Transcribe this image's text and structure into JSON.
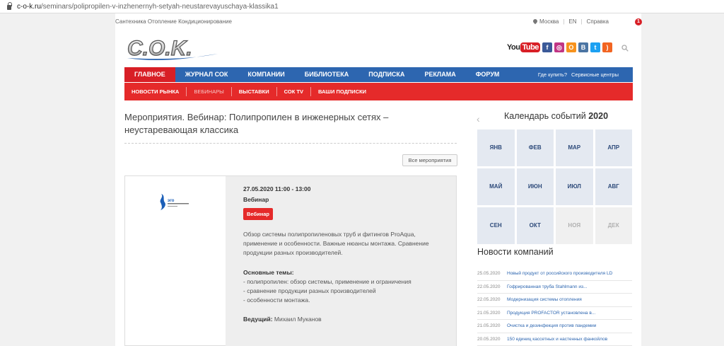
{
  "browser": {
    "url_host": "c-o-k.ru",
    "url_path": "/seminars/polipropilen-v-inzhenernyh-setyah-neustarevayuschaya-klassika1"
  },
  "topbar": {
    "categories": "Сантехника Отопление Кондиционирование",
    "city": "Москва",
    "lang": "EN",
    "help": "Справка",
    "notification_count": "1"
  },
  "header": {
    "logo_text": "C.O.K.",
    "social": [
      "youtube-icon",
      "facebook-icon",
      "instagram-icon",
      "odnoklassniki-icon",
      "vk-icon",
      "twitter-icon",
      "rss-icon"
    ],
    "youtube_you": "You",
    "youtube_tube": "Tube"
  },
  "main_nav": {
    "items": [
      "ГЛАВНОЕ",
      "ЖУРНАЛ СОК",
      "КОМПАНИИ",
      "БИБЛИОТЕКА",
      "ПОДПИСКА",
      "РЕКЛАМА",
      "ФОРУМ"
    ],
    "where_to_buy": "Где купить?",
    "service_centers": "Сервисные центры"
  },
  "sub_nav": {
    "items": [
      "НОВОСТИ РЫНКА",
      "ВЕБИНАРЫ",
      "ВЫСТАВКИ",
      "СОК TV",
      "ВАШИ ПОДПИСКИ"
    ]
  },
  "page": {
    "title": "Мероприятия. Вебинар: Полипропилен в инженерных сетях – неустаревающая классика",
    "all_events_button": "Все мероприятия"
  },
  "event": {
    "datetime": "27.05.2020  11:00 - 13:00",
    "type": "Вебинар",
    "badge": "Вебинар",
    "description": "Обзор системы полипропиленовых труб и фитингов ProAqua, применение и особенности. Важные нюансы монтажа. Сравнение продукции разных производителей.",
    "topics_heading": "Основные темы:",
    "topics": [
      "- полипропилен: обзор системы, применение и ограничения",
      "- сравнение продукции разных производителей",
      "- особенности монтажа."
    ],
    "lead_label": "Ведущий:",
    "lead_name": " Михаил Муканов",
    "logo_text": "эго"
  },
  "calendar": {
    "title": "Календарь событий",
    "year": "2020",
    "months": [
      {
        "label": "ЯНВ",
        "active": true
      },
      {
        "label": "ФЕВ",
        "active": true
      },
      {
        "label": "МАР",
        "active": true
      },
      {
        "label": "АПР",
        "active": true
      },
      {
        "label": "МАЙ",
        "active": true
      },
      {
        "label": "ИЮН",
        "active": true
      },
      {
        "label": "ИЮЛ",
        "active": true
      },
      {
        "label": "АВГ",
        "active": true
      },
      {
        "label": "СЕН",
        "active": true
      },
      {
        "label": "ОКТ",
        "active": true
      },
      {
        "label": "НОЯ",
        "active": false
      },
      {
        "label": "ДЕК",
        "active": false
      }
    ]
  },
  "news": {
    "title": "Новости компаний",
    "items": [
      {
        "date": "25.05.2020",
        "text": "Новый продукт от российского производителя LD"
      },
      {
        "date": "22.05.2020",
        "text": "Гофрированная труба Stahlmann из..."
      },
      {
        "date": "22.05.2020",
        "text": "Модернизация системы отопления"
      },
      {
        "date": "21.05.2020",
        "text": "Продукция PROFACTOR установлена в..."
      },
      {
        "date": "21.05.2020",
        "text": "Очистка и дезинфекция против пандемии"
      },
      {
        "date": "20.05.2020",
        "text": "150 единиц кассетных и настенных фанкойлов"
      }
    ]
  },
  "colors": {
    "nav_blue": "#2d66b0",
    "accent_red": "#e52a2a",
    "calendar_cell": "#e4e9f1"
  }
}
